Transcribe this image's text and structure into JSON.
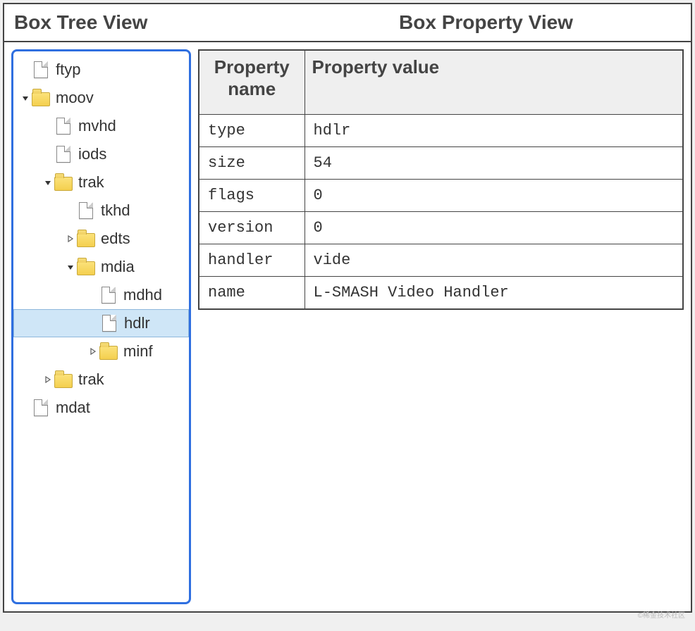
{
  "header": {
    "tree_title": "Box Tree View",
    "prop_title": "Box Property View"
  },
  "tree": [
    {
      "label": "ftyp",
      "icon": "file",
      "depth": 0,
      "toggle": "none",
      "selected": false
    },
    {
      "label": "moov",
      "icon": "folder",
      "depth": 0,
      "toggle": "open",
      "selected": false
    },
    {
      "label": "mvhd",
      "icon": "file",
      "depth": 1,
      "toggle": "none",
      "selected": false
    },
    {
      "label": "iods",
      "icon": "file",
      "depth": 1,
      "toggle": "none",
      "selected": false
    },
    {
      "label": "trak",
      "icon": "folder",
      "depth": 1,
      "toggle": "open",
      "selected": false
    },
    {
      "label": "tkhd",
      "icon": "file",
      "depth": 2,
      "toggle": "none",
      "selected": false
    },
    {
      "label": "edts",
      "icon": "folder",
      "depth": 2,
      "toggle": "closed",
      "selected": false
    },
    {
      "label": "mdia",
      "icon": "folder",
      "depth": 2,
      "toggle": "open",
      "selected": false
    },
    {
      "label": "mdhd",
      "icon": "file",
      "depth": 3,
      "toggle": "none",
      "selected": false
    },
    {
      "label": "hdlr",
      "icon": "file",
      "depth": 3,
      "toggle": "none",
      "selected": true
    },
    {
      "label": "minf",
      "icon": "folder",
      "depth": 3,
      "toggle": "closed",
      "selected": false
    },
    {
      "label": "trak",
      "icon": "folder",
      "depth": 1,
      "toggle": "closed",
      "selected": false
    },
    {
      "label": "mdat",
      "icon": "file",
      "depth": 0,
      "toggle": "none",
      "selected": false
    }
  ],
  "property_headers": {
    "name": "Property name",
    "value": "Property value"
  },
  "properties": [
    {
      "name": "type",
      "value": "hdlr"
    },
    {
      "name": "size",
      "value": "54"
    },
    {
      "name": "flags",
      "value": "0"
    },
    {
      "name": "version",
      "value": "0"
    },
    {
      "name": "handler",
      "value": "vide"
    },
    {
      "name": "name",
      "value": "L-SMASH Video Handler"
    }
  ],
  "watermark": "©稀金技术社区"
}
